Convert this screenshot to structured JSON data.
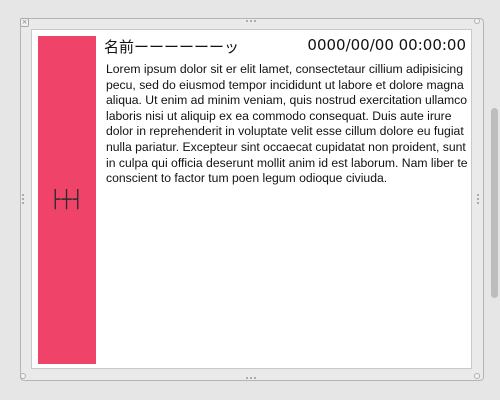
{
  "header": {
    "name": "名前ーーーーーーッ",
    "datetime": "0000/00/00 00:00:00"
  },
  "sidebar": {
    "label": "├┼┤",
    "color": "#ef4369"
  },
  "content": {
    "text": "Lorem ipsum dolor sit er elit lamet, consectetaur cillium adipisicing pecu, sed do eiusmod tempor incididunt ut labore et dolore magna aliqua. Ut enim ad minim veniam, quis nostrud exercitation ullamco laboris nisi ut aliquip ex ea commodo consequat. Duis aute irure dolor in reprehenderit in voluptate velit esse cillum dolore eu fugiat nulla pariatur. Excepteur sint occaecat cupidatat non proident, sunt in culpa qui officia deserunt mollit anim id est laborum. Nam liber te conscient to factor tum poen legum odioque civiuda."
  },
  "window": {
    "close_icon": "close-icon"
  }
}
